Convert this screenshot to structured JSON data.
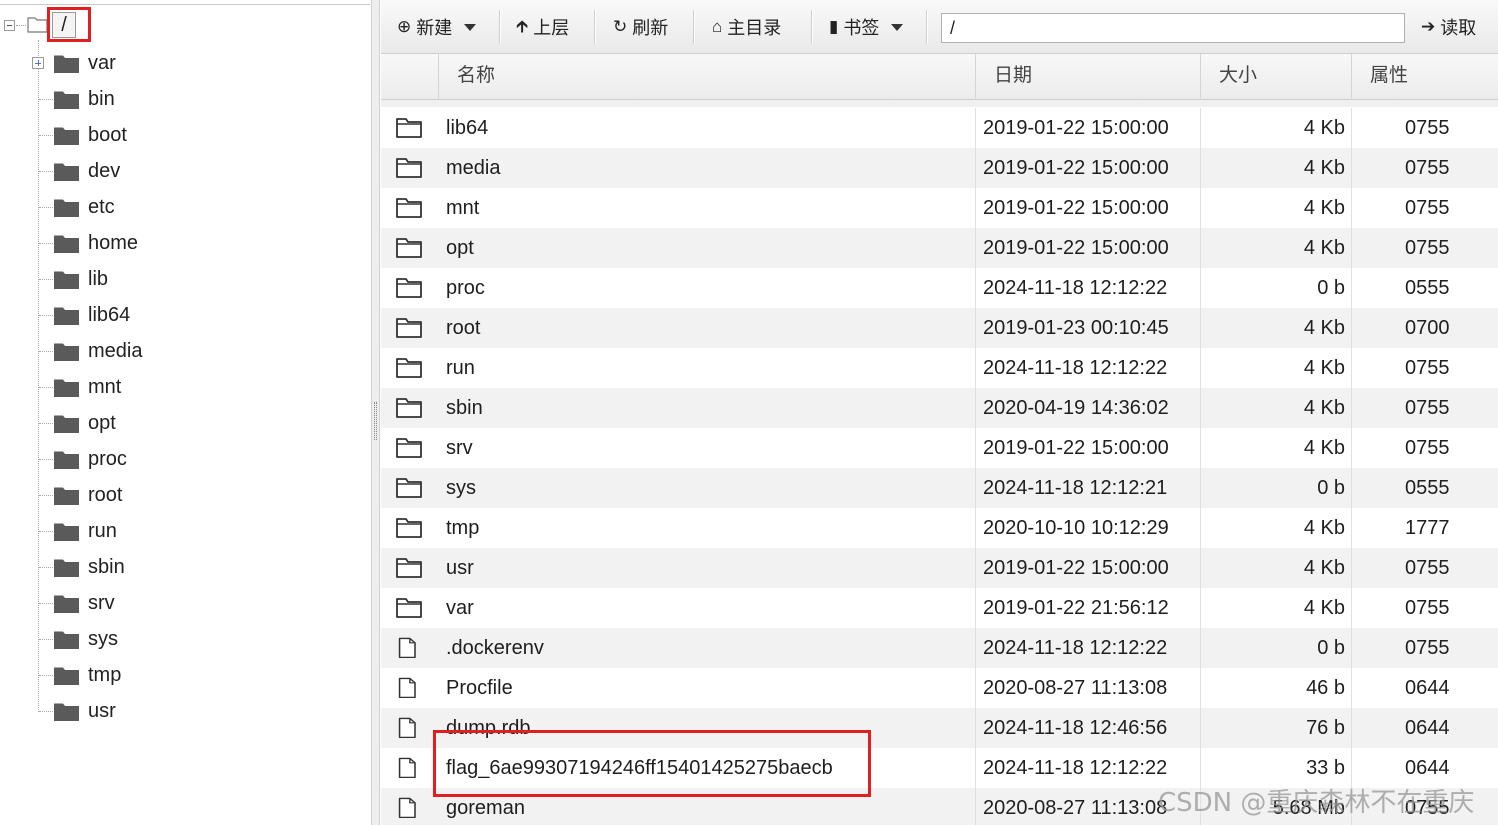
{
  "tree": {
    "root": {
      "label": "/"
    },
    "items": [
      {
        "label": "var",
        "expandable": true
      },
      {
        "label": "bin"
      },
      {
        "label": "boot"
      },
      {
        "label": "dev"
      },
      {
        "label": "etc"
      },
      {
        "label": "home"
      },
      {
        "label": "lib"
      },
      {
        "label": "lib64"
      },
      {
        "label": "media"
      },
      {
        "label": "mnt"
      },
      {
        "label": "opt"
      },
      {
        "label": "proc"
      },
      {
        "label": "root"
      },
      {
        "label": "run"
      },
      {
        "label": "sbin"
      },
      {
        "label": "srv"
      },
      {
        "label": "sys"
      },
      {
        "label": "tmp"
      },
      {
        "label": "usr"
      }
    ]
  },
  "toolbar": {
    "new_label": "新建",
    "up_label": "上层",
    "refresh_label": "刷新",
    "home_label": "主目录",
    "bookmark_label": "书签",
    "path_value": "/",
    "read_label": "读取"
  },
  "table": {
    "headers": {
      "name": "名称",
      "date": "日期",
      "size": "大小",
      "attr": "属性"
    },
    "rows": [
      {
        "type": "folder",
        "name": "lib64",
        "date": "2019-01-22 15:00:00",
        "size": "4 Kb",
        "attr": "0755"
      },
      {
        "type": "folder",
        "name": "media",
        "date": "2019-01-22 15:00:00",
        "size": "4 Kb",
        "attr": "0755"
      },
      {
        "type": "folder",
        "name": "mnt",
        "date": "2019-01-22 15:00:00",
        "size": "4 Kb",
        "attr": "0755"
      },
      {
        "type": "folder",
        "name": "opt",
        "date": "2019-01-22 15:00:00",
        "size": "4 Kb",
        "attr": "0755"
      },
      {
        "type": "folder",
        "name": "proc",
        "date": "2024-11-18 12:12:22",
        "size": "0 b",
        "attr": "0555"
      },
      {
        "type": "folder",
        "name": "root",
        "date": "2019-01-23 00:10:45",
        "size": "4 Kb",
        "attr": "0700"
      },
      {
        "type": "folder",
        "name": "run",
        "date": "2024-11-18 12:12:22",
        "size": "4 Kb",
        "attr": "0755"
      },
      {
        "type": "folder",
        "name": "sbin",
        "date": "2020-04-19 14:36:02",
        "size": "4 Kb",
        "attr": "0755"
      },
      {
        "type": "folder",
        "name": "srv",
        "date": "2019-01-22 15:00:00",
        "size": "4 Kb",
        "attr": "0755"
      },
      {
        "type": "folder",
        "name": "sys",
        "date": "2024-11-18 12:12:21",
        "size": "0 b",
        "attr": "0555"
      },
      {
        "type": "folder",
        "name": "tmp",
        "date": "2020-10-10 10:12:29",
        "size": "4 Kb",
        "attr": "1777"
      },
      {
        "type": "folder",
        "name": "usr",
        "date": "2019-01-22 15:00:00",
        "size": "4 Kb",
        "attr": "0755"
      },
      {
        "type": "folder",
        "name": "var",
        "date": "2019-01-22 21:56:12",
        "size": "4 Kb",
        "attr": "0755"
      },
      {
        "type": "file",
        "name": ".dockerenv",
        "date": "2024-11-18 12:12:22",
        "size": "0 b",
        "attr": "0755"
      },
      {
        "type": "file",
        "name": "Procfile",
        "date": "2020-08-27 11:13:08",
        "size": "46 b",
        "attr": "0644"
      },
      {
        "type": "file",
        "name": "dump.rdb",
        "date": "2024-11-18 12:46:56",
        "size": "76 b",
        "attr": "0644"
      },
      {
        "type": "file",
        "name": "flag_6ae99307194246ff15401425275baecb",
        "date": "2024-11-18 12:12:22",
        "size": "33 b",
        "attr": "0644"
      },
      {
        "type": "file",
        "name": "goreman",
        "date": "2020-08-27 11:13:08",
        "size": "5.68 Mb",
        "attr": "0755"
      }
    ]
  },
  "watermark": "CSDN @重庆森林不在重庆",
  "colors": {
    "highlight": "#e02020",
    "alt_row": "#f2f2f2",
    "toolbar_bg": "#efefef"
  }
}
